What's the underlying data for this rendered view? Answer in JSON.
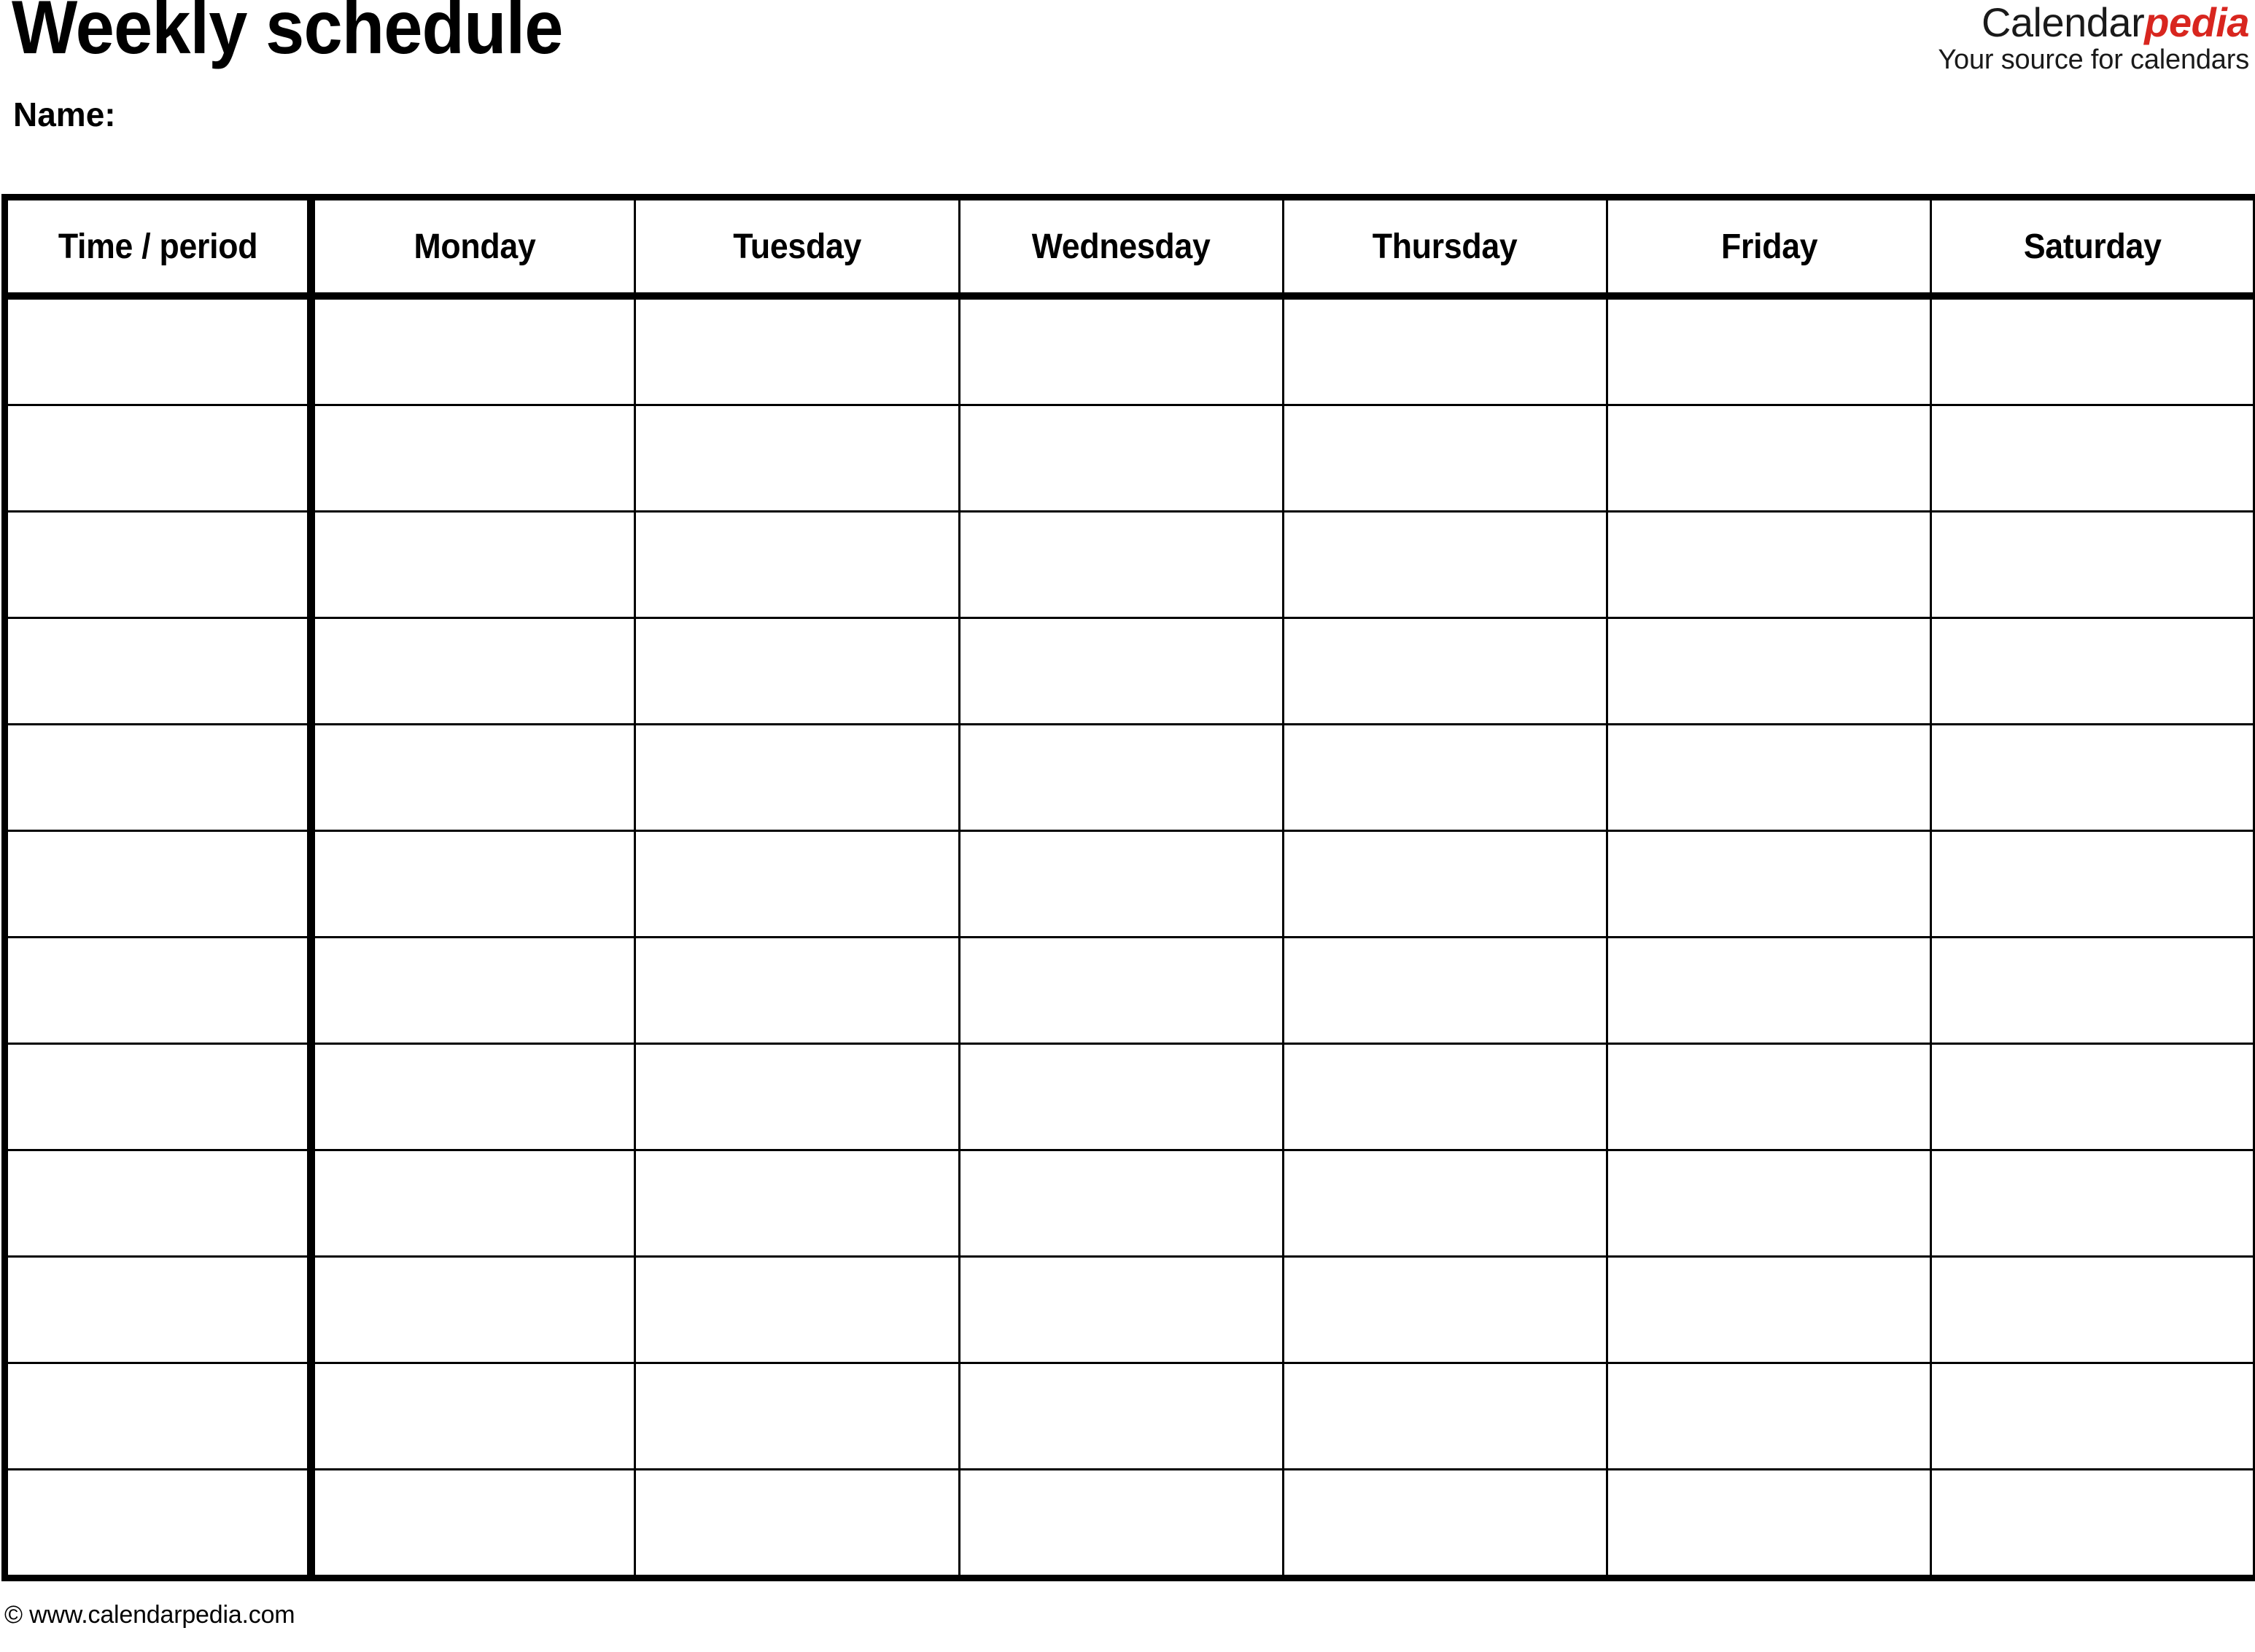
{
  "document": {
    "title": "Weekly schedule",
    "name_label": "Name:"
  },
  "brand": {
    "wordmark_part1": "Calendar",
    "wordmark_part2": "pedia",
    "tagline": "Your source for calendars",
    "accent_color": "#d8261f",
    "text_color": "#1a1a1a"
  },
  "table": {
    "columns": [
      "Time / period",
      "Monday",
      "Tuesday",
      "Wednesday",
      "Thursday",
      "Friday",
      "Saturday"
    ],
    "row_count": 12,
    "rows": [
      [
        "",
        "",
        "",
        "",
        "",
        "",
        ""
      ],
      [
        "",
        "",
        "",
        "",
        "",
        "",
        ""
      ],
      [
        "",
        "",
        "",
        "",
        "",
        "",
        ""
      ],
      [
        "",
        "",
        "",
        "",
        "",
        "",
        ""
      ],
      [
        "",
        "",
        "",
        "",
        "",
        "",
        ""
      ],
      [
        "",
        "",
        "",
        "",
        "",
        "",
        ""
      ],
      [
        "",
        "",
        "",
        "",
        "",
        "",
        ""
      ],
      [
        "",
        "",
        "",
        "",
        "",
        "",
        ""
      ],
      [
        "",
        "",
        "",
        "",
        "",
        "",
        ""
      ],
      [
        "",
        "",
        "",
        "",
        "",
        "",
        ""
      ],
      [
        "",
        "",
        "",
        "",
        "",
        "",
        ""
      ],
      [
        "",
        "",
        "",
        "",
        "",
        "",
        ""
      ]
    ]
  },
  "footer": {
    "copyright": "© www.calendarpedia.com"
  }
}
